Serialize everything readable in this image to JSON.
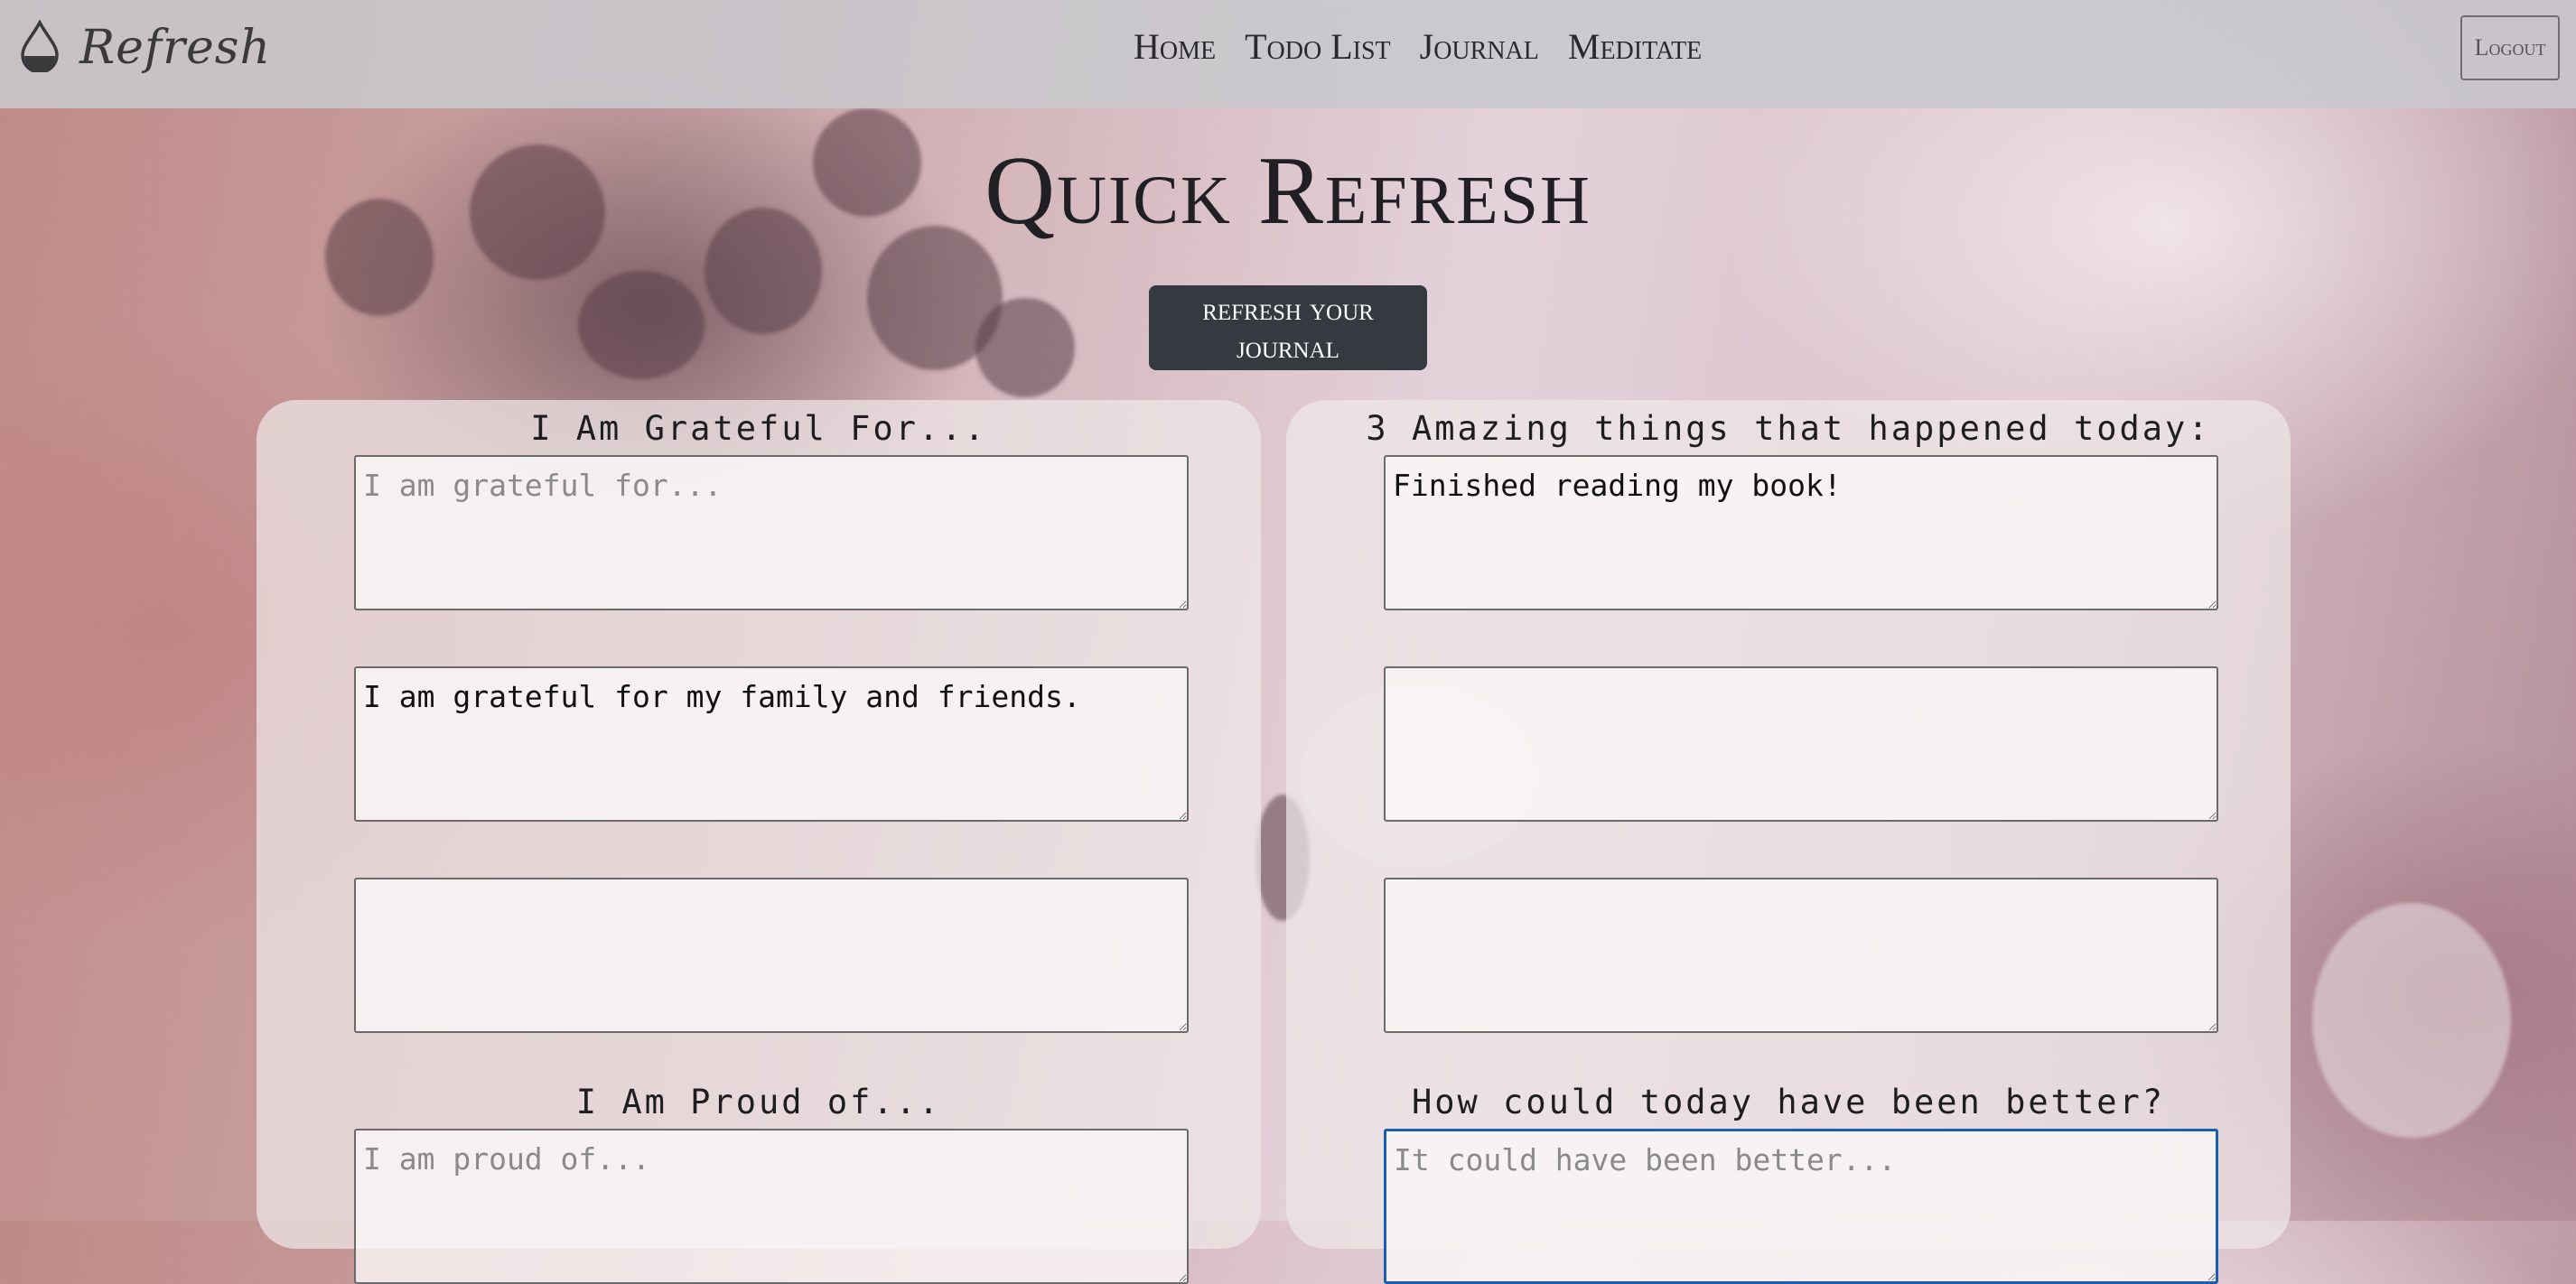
{
  "navbar": {
    "brand": "Refresh",
    "links": [
      "Home",
      "Todo List",
      "Journal",
      "Meditate"
    ],
    "logout_label": "Logout"
  },
  "page": {
    "title": "Quick Refresh",
    "refresh_button_label": "refresh your journal"
  },
  "grateful": {
    "heading": "I Am Grateful For...",
    "entries": [
      {
        "value": "",
        "placeholder": "I am grateful for..."
      },
      {
        "value": "I am grateful for my family and friends.",
        "placeholder": ""
      },
      {
        "value": "",
        "placeholder": ""
      }
    ]
  },
  "amazing": {
    "heading": "3 Amazing things that happened today:",
    "entries": [
      {
        "value": "Finished reading my book!",
        "placeholder": ""
      },
      {
        "value": "",
        "placeholder": ""
      },
      {
        "value": "",
        "placeholder": ""
      }
    ]
  },
  "proud": {
    "heading": "I Am Proud of...",
    "entries": [
      {
        "value": "",
        "placeholder": "I am proud of..."
      }
    ]
  },
  "better": {
    "heading": "How could today have been better?",
    "entries": [
      {
        "value": "",
        "placeholder": "It could have been better..."
      }
    ]
  },
  "colors": {
    "navbar_bg": "#c8c8cd",
    "button_dark": "#343a40",
    "focus_ring": "#1a5fb4"
  },
  "icons": {
    "brand": "water-drop-icon"
  }
}
